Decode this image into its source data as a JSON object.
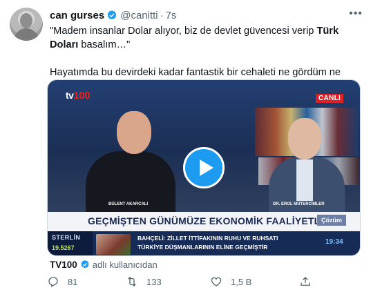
{
  "tweet": {
    "author_name": "can gurses",
    "author_handle": "@canitti",
    "separator": "·",
    "timestamp": "7s",
    "more_icon": "more-horizontal-icon",
    "text_line1_pre": "\"Madem insanlar Dolar alıyor, biz de devlet güvencesi verip ",
    "text_line1_bold": "Türk Doları",
    "text_line1_post": " basalım…\"",
    "text_line2": "Hayatımda bu devirdeki kadar fantastik bir cehaleti ne gördüm ne duydum…"
  },
  "video": {
    "channel_logo_prefix": "tv",
    "channel_logo_number": "100",
    "live_badge": "CANLI",
    "guest_left_name": "BÜLENT AKARCALI",
    "guest_right_name": "DR. EROL MÜTERCİMLER",
    "lower_third_title": "GEÇMİŞTEN GÜNÜMÜZE EKONOMİK FAALİYETLER",
    "tag": "Çözüm",
    "ticker_label": "STERLİN",
    "ticker_value": "19.5267",
    "news_line1": "BAHÇELİ: ZİLLET İTTİFAKININ RUHU VE RUHSATI",
    "news_line2": "TÜRKİYE DÜŞMANLARININ ELİNE GEÇMİŞTİR",
    "clock": "19:34"
  },
  "source": {
    "name": "TV100",
    "subtitle": "adlı kullanıcıdan"
  },
  "actions": {
    "reply_count": "81",
    "retweet_count": "133",
    "like_count": "1,5 B"
  },
  "colors": {
    "accent": "#1d9bf0",
    "text_primary": "#0f1419",
    "text_secondary": "#536471"
  }
}
